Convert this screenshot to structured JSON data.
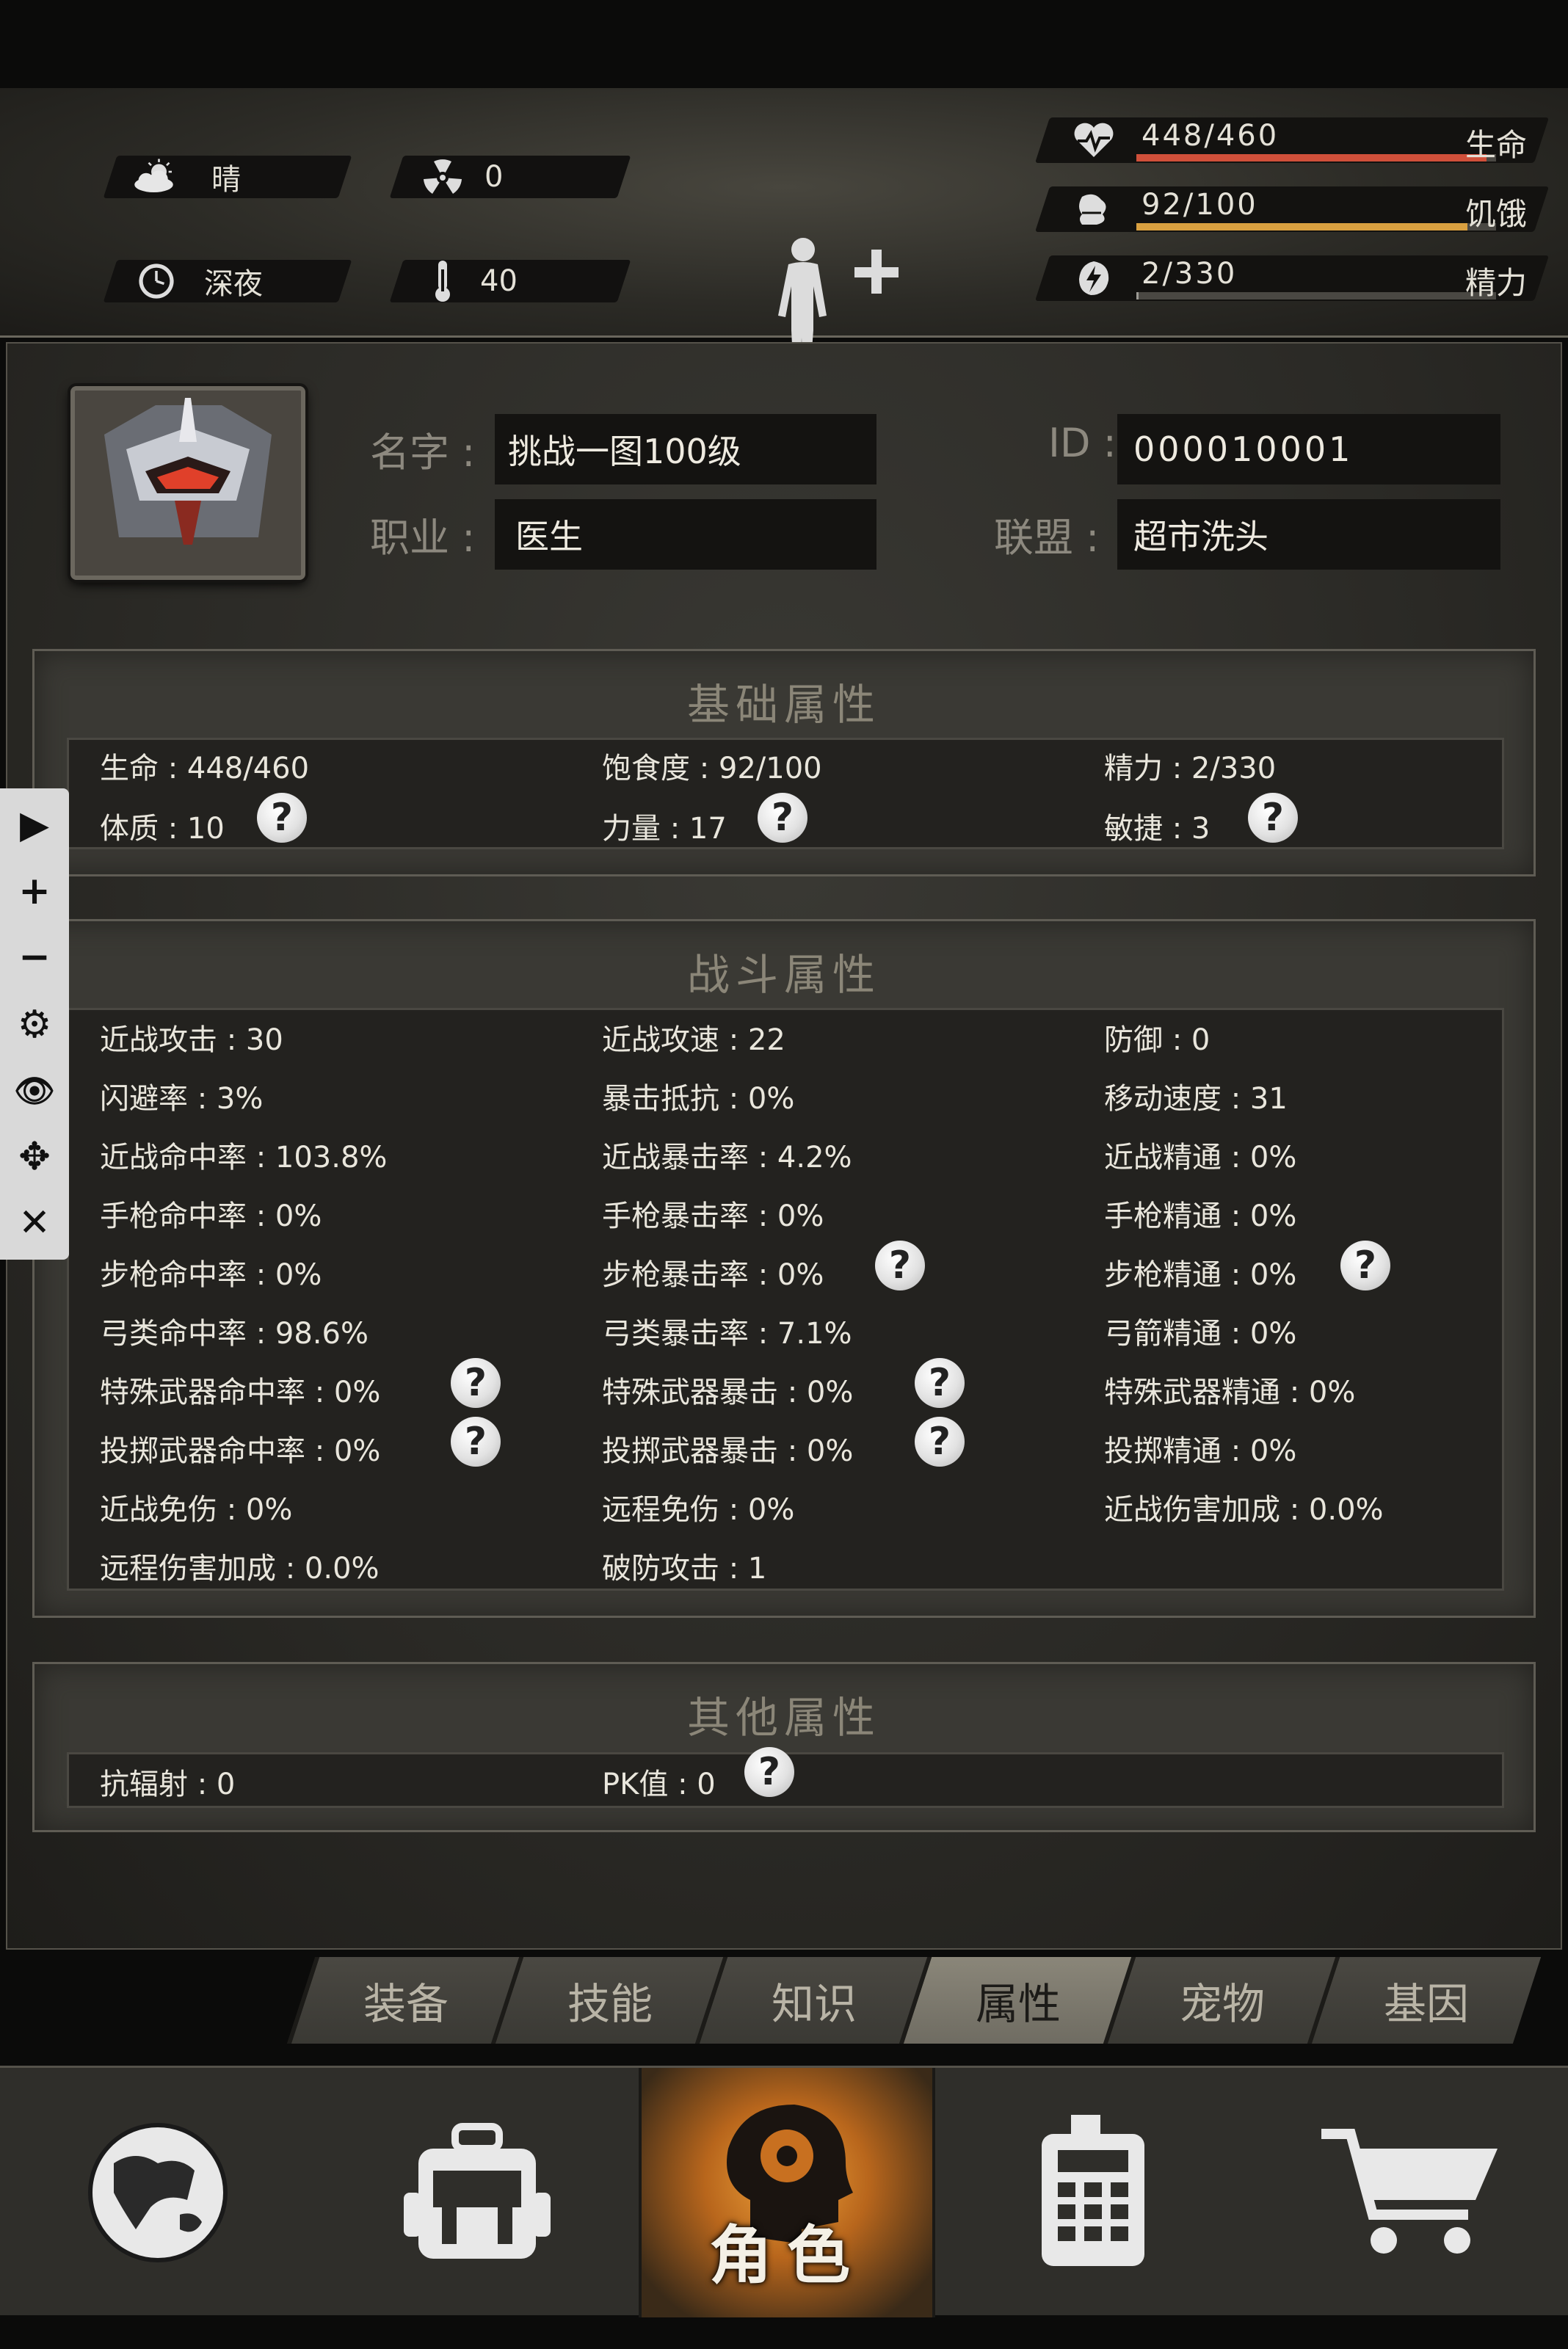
{
  "weather": {
    "condition": "晴",
    "radiation": "0",
    "time": "深夜",
    "temperature": "40"
  },
  "vitals": {
    "health": {
      "value": "448/460",
      "label": "生命",
      "fraction": 0.974,
      "color": "#d0503a"
    },
    "hunger": {
      "value": "92/100",
      "label": "饥饿",
      "fraction": 0.92,
      "color": "#d9a040"
    },
    "energy": {
      "value": "2/330",
      "label": "精力",
      "fraction": 0.006,
      "color": "#9c9a94"
    }
  },
  "profile": {
    "name_label": "名字 :",
    "name": "挑战一图100级",
    "id_label": "ID :",
    "id": "000010001",
    "job_label": "职业 :",
    "job": "医生",
    "alliance_label": "联盟 :",
    "alliance": "超市洗头"
  },
  "basic": {
    "title": "基础属性",
    "rows": [
      [
        "生命 : 448/460",
        "饱食度 : 92/100",
        "精力 : 2/330"
      ],
      [
        "体质 : 10",
        "力量 : 17",
        "敏捷 : 3"
      ]
    ]
  },
  "combat": {
    "title": "战斗属性",
    "rows": [
      [
        "近战攻击 : 30",
        "近战攻速 : 22",
        "防御 : 0"
      ],
      [
        "闪避率 : 3%",
        "暴击抵抗 : 0%",
        "移动速度 : 31"
      ],
      [
        "近战命中率 : 103.8%",
        "近战暴击率 : 4.2%",
        "近战精通 : 0%"
      ],
      [
        "手枪命中率 : 0%",
        "手枪暴击率 : 0%",
        "手枪精通 : 0%"
      ],
      [
        "步枪命中率 : 0%",
        "步枪暴击率 : 0%",
        "步枪精通 : 0%"
      ],
      [
        "弓类命中率 : 98.6%",
        "弓类暴击率 : 7.1%",
        "弓箭精通 : 0%"
      ],
      [
        "特殊武器命中率 : 0%",
        "特殊武器暴击 : 0%",
        "特殊武器精通 : 0%"
      ],
      [
        "投掷武器命中率 : 0%",
        "投掷武器暴击 : 0%",
        "投掷精通 : 0%"
      ],
      [
        "近战免伤 : 0%",
        "远程免伤 : 0%",
        "近战伤害加成 : 0.0%"
      ],
      [
        "远程伤害加成 : 0.0%",
        "破防攻击 : 1",
        ""
      ]
    ]
  },
  "other": {
    "title": "其他属性",
    "rows": [
      [
        "抗辐射 : 0",
        "PK值 : 0",
        ""
      ]
    ]
  },
  "help_glyph": "?",
  "toolbar": {
    "play": "▶",
    "zoom_in": "+",
    "zoom_out": "−",
    "settings": "⚙",
    "view": "👁",
    "move": "✥",
    "close": "✕"
  },
  "tabs": [
    "装备",
    "技能",
    "知识",
    "属性",
    "宠物",
    "基因"
  ],
  "active_tab": "属性",
  "nav": {
    "active_label": "角色"
  },
  "icons": [
    "weather-sunny-cloud-icon",
    "radiation-icon",
    "clock-icon",
    "thermometer-icon",
    "heart-icon",
    "stomach-icon",
    "energy-icon",
    "body-figure-icon",
    "globe-icon",
    "backpack-icon",
    "character-head-icon",
    "phone-icon",
    "cart-icon"
  ]
}
